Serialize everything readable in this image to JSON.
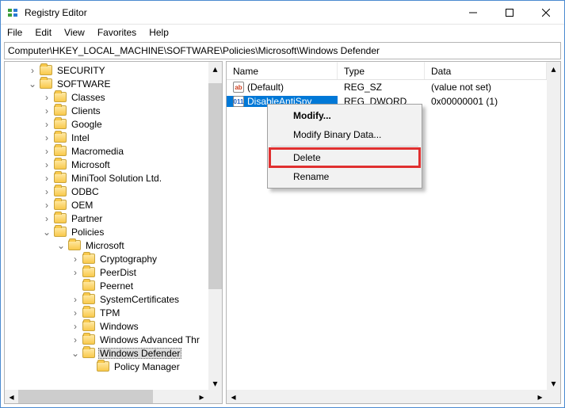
{
  "window": {
    "title": "Registry Editor"
  },
  "menu": {
    "file": "File",
    "edit": "Edit",
    "view": "View",
    "favorites": "Favorites",
    "help": "Help"
  },
  "address": "Computer\\HKEY_LOCAL_MACHINE\\SOFTWARE\\Policies\\Microsoft\\Windows Defender",
  "tree": {
    "n0": "SECURITY",
    "n1": "SOFTWARE",
    "n2": "Classes",
    "n3": "Clients",
    "n4": "Google",
    "n5": "Intel",
    "n6": "Macromedia",
    "n7": "Microsoft",
    "n8": "MiniTool Solution Ltd.",
    "n9": "ODBC",
    "n10": "OEM",
    "n11": "Partner",
    "n12": "Policies",
    "n13": "Microsoft",
    "n14": "Cryptography",
    "n15": "PeerDist",
    "n16": "Peernet",
    "n17": "SystemCertificates",
    "n18": "TPM",
    "n19": "Windows",
    "n20": "Windows Advanced Thr",
    "n21": "Windows Defender",
    "n22": "Policy Manager"
  },
  "list": {
    "hdr": {
      "name": "Name",
      "type": "Type",
      "data": "Data"
    },
    "r0": {
      "name": "(Default)",
      "type": "REG_SZ",
      "data": "(value not set)"
    },
    "r1": {
      "name": "DisableAntiSpy",
      "type": "REG_DWORD",
      "data": "0x00000001 (1)"
    }
  },
  "context": {
    "modify": "Modify...",
    "modify_binary": "Modify Binary Data...",
    "delete": "Delete",
    "rename": "Rename"
  }
}
